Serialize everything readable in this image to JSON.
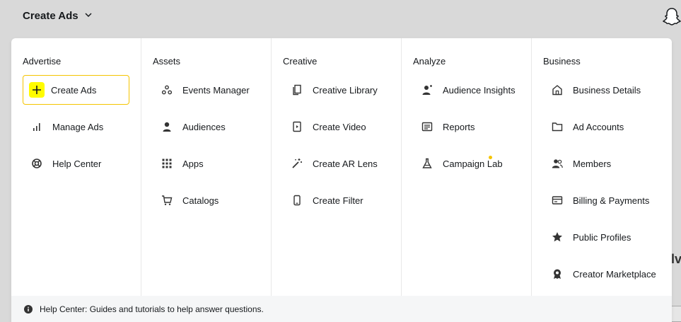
{
  "topbar": {
    "app_title": "Create Ads",
    "icons": {
      "chevron": "chevron-down-icon",
      "ghost": "snapchat-ghost-icon"
    }
  },
  "background_text": "lv",
  "menu": {
    "accent_color": "#fffc00",
    "active_border_color": "#f5c400",
    "columns": [
      {
        "heading": "Advertise",
        "items": [
          {
            "label": "Create Ads",
            "icon": "plus-icon",
            "active": true
          },
          {
            "label": "Manage Ads",
            "icon": "bar-chart-icon"
          },
          {
            "label": "Help Center",
            "icon": "lifebuoy-icon"
          }
        ]
      },
      {
        "heading": "Assets",
        "items": [
          {
            "label": "Events Manager",
            "icon": "nodes-icon"
          },
          {
            "label": "Audiences",
            "icon": "person-icon"
          },
          {
            "label": "Apps",
            "icon": "grid-icon"
          },
          {
            "label": "Catalogs",
            "icon": "cart-icon"
          }
        ]
      },
      {
        "heading": "Creative",
        "items": [
          {
            "label": "Creative Library",
            "icon": "stack-icon"
          },
          {
            "label": "Create Video",
            "icon": "video-icon"
          },
          {
            "label": "Create AR Lens",
            "icon": "magic-wand-icon"
          },
          {
            "label": "Create Filter",
            "icon": "phone-icon"
          }
        ]
      },
      {
        "heading": "Analyze",
        "items": [
          {
            "label": "Audience Insights",
            "icon": "person-sparkle-icon"
          },
          {
            "label": "Reports",
            "icon": "report-icon"
          },
          {
            "label": "Campaign Lab",
            "icon": "flask-icon",
            "new_dot": true
          }
        ]
      },
      {
        "heading": "Business",
        "items": [
          {
            "label": "Business Details",
            "icon": "home-icon"
          },
          {
            "label": "Ad Accounts",
            "icon": "folder-icon"
          },
          {
            "label": "Members",
            "icon": "members-icon"
          },
          {
            "label": "Billing & Payments",
            "icon": "card-icon"
          },
          {
            "label": "Public Profiles",
            "icon": "star-icon"
          },
          {
            "label": "Creator Marketplace",
            "icon": "award-icon"
          }
        ]
      }
    ],
    "footer_text": "Help Center: Guides and tutorials to help answer questions."
  }
}
